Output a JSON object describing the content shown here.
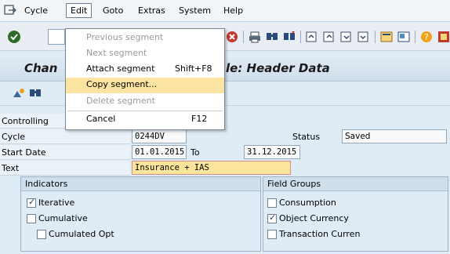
{
  "menubar": {
    "items": [
      {
        "label": "Cycle"
      },
      {
        "label": "Edit"
      },
      {
        "label": "Goto"
      },
      {
        "label": "Extras"
      },
      {
        "label": "System"
      },
      {
        "label": "Help"
      }
    ]
  },
  "title": {
    "left": "Chan",
    "right": "le: Header Data"
  },
  "dropdown": {
    "items": [
      {
        "label": "Previous segment",
        "shortcut": "",
        "enabled": false,
        "highlighted": false
      },
      {
        "label": "Next segment",
        "shortcut": "",
        "enabled": false,
        "highlighted": false
      },
      {
        "label": "Attach segment",
        "shortcut": "Shift+F8",
        "enabled": true,
        "highlighted": false
      },
      {
        "label": "Copy segment...",
        "shortcut": "",
        "enabled": true,
        "highlighted": true
      },
      {
        "label": "Delete segment",
        "shortcut": "",
        "enabled": false,
        "highlighted": false
      },
      {
        "label": "Cancel",
        "shortcut": "F12",
        "enabled": true,
        "highlighted": false
      }
    ]
  },
  "form": {
    "controlling_label": "Controlling",
    "cycle_label": "Cycle",
    "cycle_value": "0244DV",
    "status_label": "Status",
    "status_value": "Saved",
    "start_date_label": "Start Date",
    "start_date_value": "01.01.2015",
    "to_label": "To",
    "end_date_value": "31.12.2015",
    "text_label": "Text",
    "text_value": "Insurance + IAS"
  },
  "indicators": {
    "title": "Indicators",
    "items": [
      {
        "label": "Iterative",
        "checked": true
      },
      {
        "label": "Cumulative",
        "checked": false
      },
      {
        "label": "Cumulated Opt",
        "checked": false
      }
    ]
  },
  "field_groups": {
    "title": "Field Groups",
    "items": [
      {
        "label": "Consumption",
        "checked": false
      },
      {
        "label": "Object Currency",
        "checked": true
      },
      {
        "label": "Transaction Curren",
        "checked": false
      }
    ]
  },
  "colors": {
    "highlight": "#fbe3a1",
    "active_field": "#fbe59a",
    "background": "#dfebf5"
  }
}
